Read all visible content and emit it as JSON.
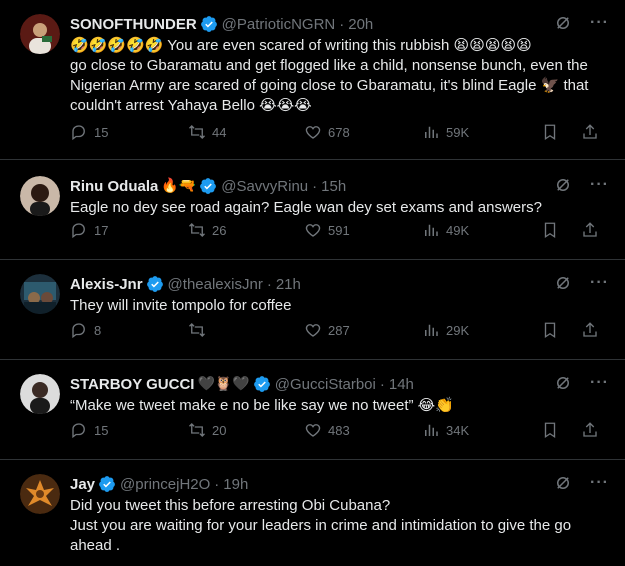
{
  "tweets": [
    {
      "display_name": "SONOFTHUNDER",
      "name_emoji": "",
      "handle": "@PatrioticNGRN",
      "time": "20h",
      "avatar_color": "#7a2a1f",
      "text": "🤣🤣🤣🤣🤣 You are even scared of writing this rubbish 😫😫😫😫😫\ngo close to Gbaramatu and get flogged like a child, nonsense bunch, even the Nigerian Army are scared of going close to Gbaramatu, it's blind Eagle 🦅 that couldn't arrest Yahaya Bello 😭😭😭",
      "replies": "15",
      "retweets": "44",
      "likes": "678",
      "views": "59K"
    },
    {
      "display_name": "Rinu Oduala",
      "name_emoji": "🔥🔫",
      "handle": "@SavvyRinu",
      "time": "15h",
      "avatar_color": "#3b2a22",
      "text": "Eagle no dey see road again? Eagle wan dey set exams and answers?",
      "replies": "17",
      "retweets": "26",
      "likes": "591",
      "views": "49K"
    },
    {
      "display_name": "Alexis-Jnr",
      "name_emoji": "",
      "handle": "@thealexisJnr",
      "time": "21h",
      "avatar_color": "#1f3a4a",
      "text": "They will invite tompolo for coffee",
      "replies": "8",
      "retweets": "",
      "likes": "287",
      "views": "29K"
    },
    {
      "display_name": "STARBOY GUCCI",
      "name_emoji": "🖤🦉🖤",
      "handle": "@GucciStarboi",
      "time": "14h",
      "avatar_color": "#2b2b2b",
      "text": "“Make we tweet make e no be like say we no tweet” 😂👏",
      "replies": "15",
      "retweets": "20",
      "likes": "483",
      "views": "34K"
    },
    {
      "display_name": "Jay",
      "name_emoji": "",
      "handle": "@princejH2O",
      "time": "19h",
      "avatar_color": "#b5651d",
      "text": "Did you tweet this before arresting Obi Cubana?\nJust you are waiting for your leaders in crime and intimidation to give the go ahead .",
      "replies": "",
      "retweets": "",
      "likes": "",
      "views": ""
    }
  ],
  "colors": {
    "background": "#000000",
    "text": "#e7e9ea",
    "muted": "#71767b",
    "verified": "#1d9bf0",
    "divider": "#2f3336"
  }
}
